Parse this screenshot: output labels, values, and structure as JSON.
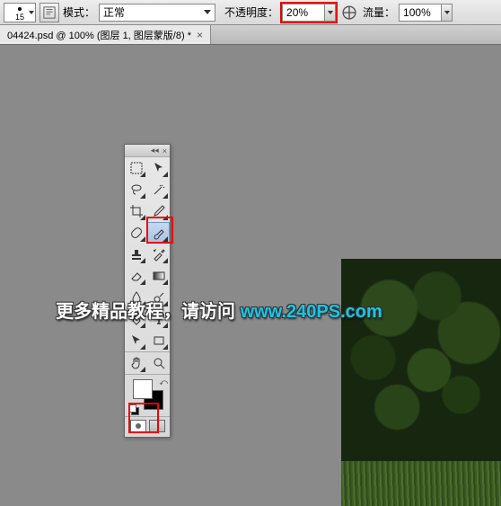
{
  "options": {
    "brush_size": "15",
    "mode_label": "模式：",
    "mode_value": "正常",
    "opacity_label": "不透明度：",
    "opacity_value": "20%",
    "flow_label": "流量：",
    "flow_value": "100%"
  },
  "tab": {
    "title": "04424.psd @ 100% (图层 1, 图层蒙版/8) *",
    "close": "×"
  },
  "tools_header": {
    "collapse": "◂◂",
    "close": "×"
  },
  "watermark": {
    "text": "更多精品教程，请访问 ",
    "url": "www.240PS.com"
  }
}
